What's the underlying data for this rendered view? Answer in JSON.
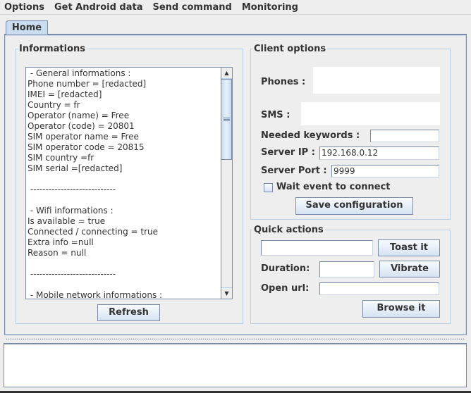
{
  "menubar": {
    "items": [
      "Options",
      "Get Android data",
      "Send command",
      "Monitoring"
    ]
  },
  "tabs": [
    {
      "label": "Home",
      "selected": true
    }
  ],
  "informations": {
    "title": "Informations",
    "lines": [
      " - General informations :",
      "Phone number = [redacted]",
      "IMEI = [redacted]",
      "Country = fr",
      "Operator (name) = Free",
      "Operator (code) = 20801",
      "SIM operator name = Free",
      "SIM operator code = 20815",
      "SIM country =fr",
      "SIM serial =[redacted]",
      "",
      " ----------------------------",
      "",
      " - Wifi informations :",
      "Is available = true",
      "Connected / connecting = true",
      "Extra info =null",
      "Reason = null",
      "",
      " ----------------------------",
      "",
      " - Mobile network informations :"
    ],
    "scroll_up_icon": "▲",
    "scroll_down_icon": "▼",
    "refresh_label": "Refresh"
  },
  "client_options": {
    "title": "Client options",
    "phones_label": "Phones :",
    "phones_value": "",
    "sms_label": "SMS :",
    "sms_value": "",
    "keywords_label": "Needed keywords :",
    "keywords_value": "",
    "server_ip_label": "Server IP :",
    "server_ip_value": "192.168.0.12",
    "server_port_label": "Server Port :",
    "server_port_value": "9999",
    "wait_event_label": "Wait event to connect",
    "wait_event_checked": false,
    "save_label": "Save configuration"
  },
  "quick_actions": {
    "title": "Quick actions",
    "toast_value": "",
    "toast_label": "Toast it",
    "duration_label": "Duration:",
    "duration_value": "",
    "vibrate_label": "Vibrate",
    "open_url_label": "Open url:",
    "open_url_value": "",
    "browse_label": "Browse it"
  },
  "log": {
    "content": ""
  }
}
